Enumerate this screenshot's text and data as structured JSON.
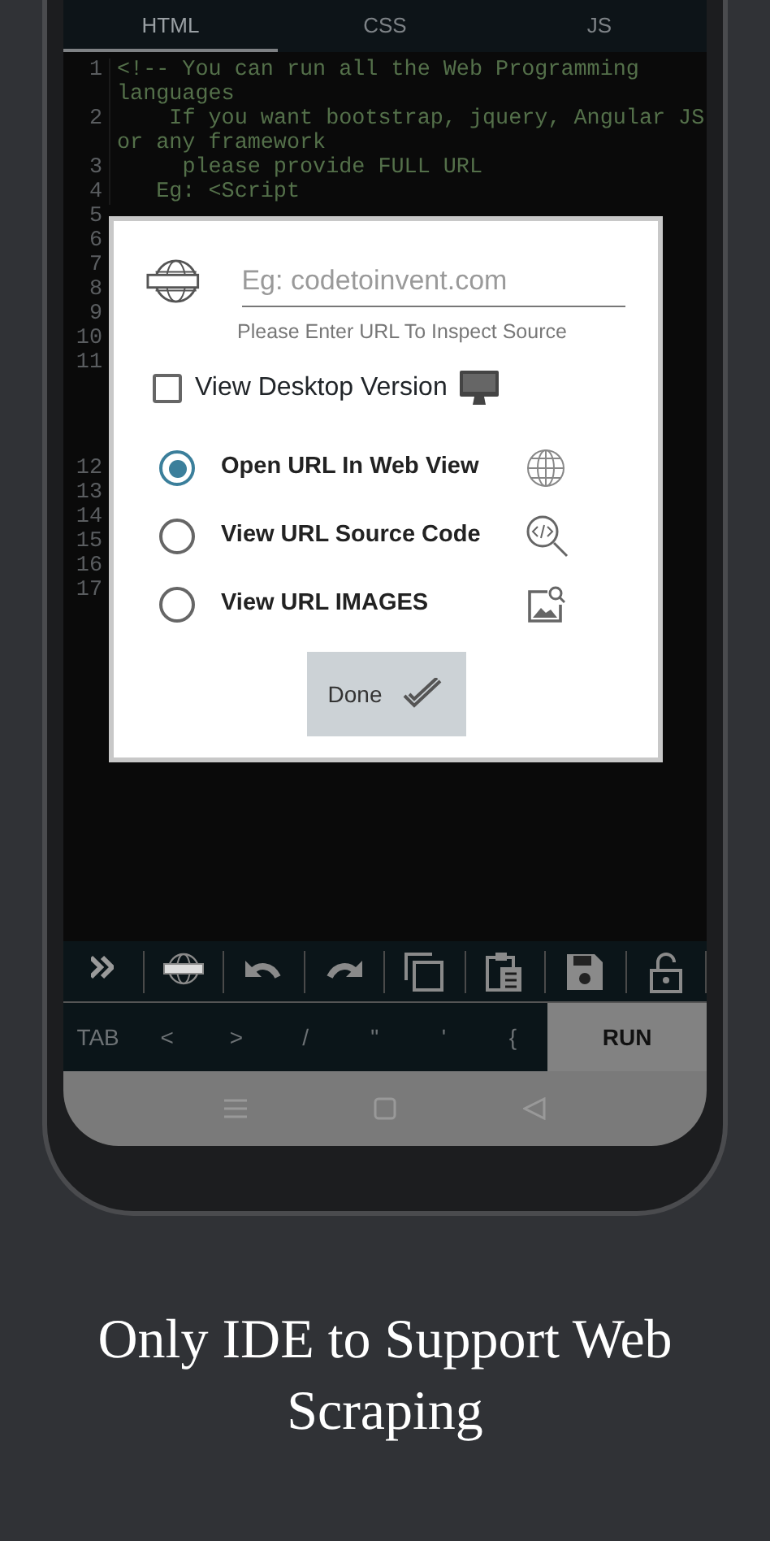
{
  "tabs": [
    {
      "label": "HTML",
      "selected": true
    },
    {
      "label": "CSS",
      "selected": false
    },
    {
      "label": "JS",
      "selected": false
    }
  ],
  "editor": {
    "lines": [
      {
        "number": "1",
        "text": "<!-- You can run all the Web Programming languages"
      },
      {
        "number": "2",
        "text": "    If you want bootstrap, jquery, Angular JS or any framework"
      },
      {
        "number": "3",
        "text": "     please provide FULL URL"
      },
      {
        "number": "4",
        "text": "   Eg: <Script"
      },
      {
        "number": "5"
      },
      {
        "number": "6"
      },
      {
        "number": "7"
      },
      {
        "number": "8"
      },
      {
        "number": "9"
      },
      {
        "number": "10"
      },
      {
        "number": "11"
      },
      {
        "number": "12"
      },
      {
        "number": "13"
      },
      {
        "number": "14"
      },
      {
        "number": "15"
      },
      {
        "number": "16"
      },
      {
        "number": "17"
      }
    ]
  },
  "dialog": {
    "url_field": {
      "placeholder": "Eg: codetoinvent.com"
    },
    "hint": "Please Enter URL To Inspect Source",
    "desktop_checkbox": {
      "label": "View Desktop Version",
      "checked": false
    },
    "options": [
      {
        "label": "Open URL In Web View",
        "selected": true,
        "kind": "globe"
      },
      {
        "label": "View URL Source Code",
        "selected": false,
        "kind": "code"
      },
      {
        "label": "View URL IMAGES",
        "selected": false,
        "kind": "image"
      }
    ],
    "done_button": "Done"
  },
  "keys": [
    "TAB",
    "<",
    ">",
    "/",
    "\"",
    "'",
    "{"
  ],
  "run_button": "RUN",
  "caption": "Only IDE to Support Web Scraping"
}
